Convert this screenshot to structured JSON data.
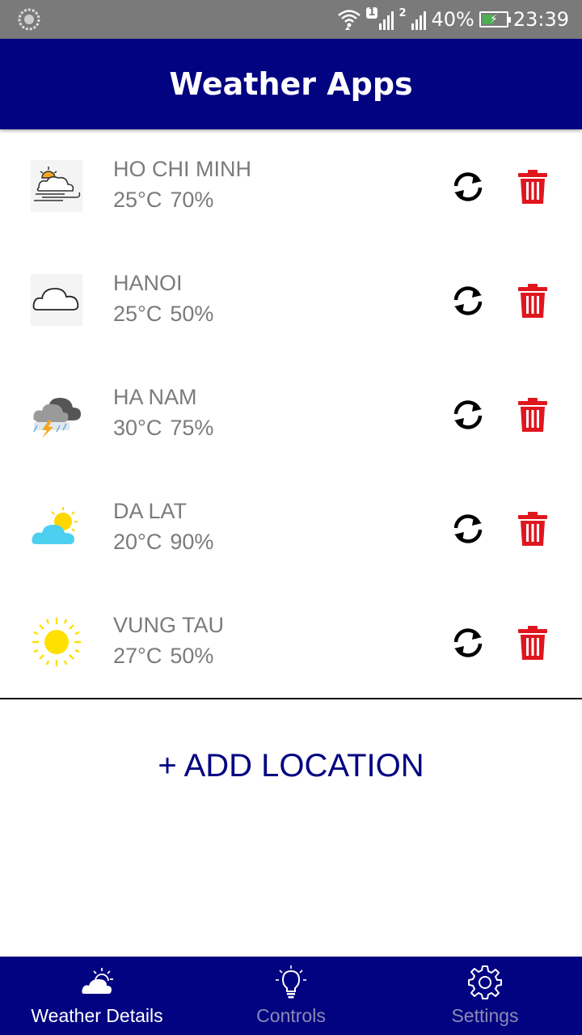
{
  "status_bar": {
    "sim1_label": "1",
    "sim2_label": "2",
    "battery_percent": "40%",
    "time": "23:39",
    "battery_level": 0.4,
    "charging": true
  },
  "app_bar": {
    "title": "Weather Apps"
  },
  "locations": [
    {
      "city": "HO CHI MINH",
      "temperature": "25°C",
      "humidity": "70%",
      "condition_icon": "cloud-sun-wind-icon"
    },
    {
      "city": "HANOI",
      "temperature": "25°C",
      "humidity": "50%",
      "condition_icon": "cloud-icon"
    },
    {
      "city": "HA NAM",
      "temperature": "30°C",
      "humidity": "75%",
      "condition_icon": "thunderstorm-icon"
    },
    {
      "city": "DA LAT",
      "temperature": "20°C",
      "humidity": "90%",
      "condition_icon": "partly-cloudy-icon"
    },
    {
      "city": "VUNG TAU",
      "temperature": "27°C",
      "humidity": "50%",
      "condition_icon": "sun-icon"
    }
  ],
  "actions": {
    "refresh_icon": "refresh-icon",
    "delete_icon": "trash-icon",
    "delete_color": "#e0161f"
  },
  "add_location_label": "+ ADD LOCATION",
  "bottom_nav": {
    "items": [
      {
        "label": "Weather Details",
        "icon": "cloud-sun-icon",
        "active": true
      },
      {
        "label": "Controls",
        "icon": "lightbulb-icon",
        "active": false
      },
      {
        "label": "Settings",
        "icon": "gear-icon",
        "active": false
      }
    ]
  },
  "colors": {
    "primary": "#020381",
    "status_bar": "#7a7a7a",
    "text_secondary": "#7b7b7b"
  }
}
